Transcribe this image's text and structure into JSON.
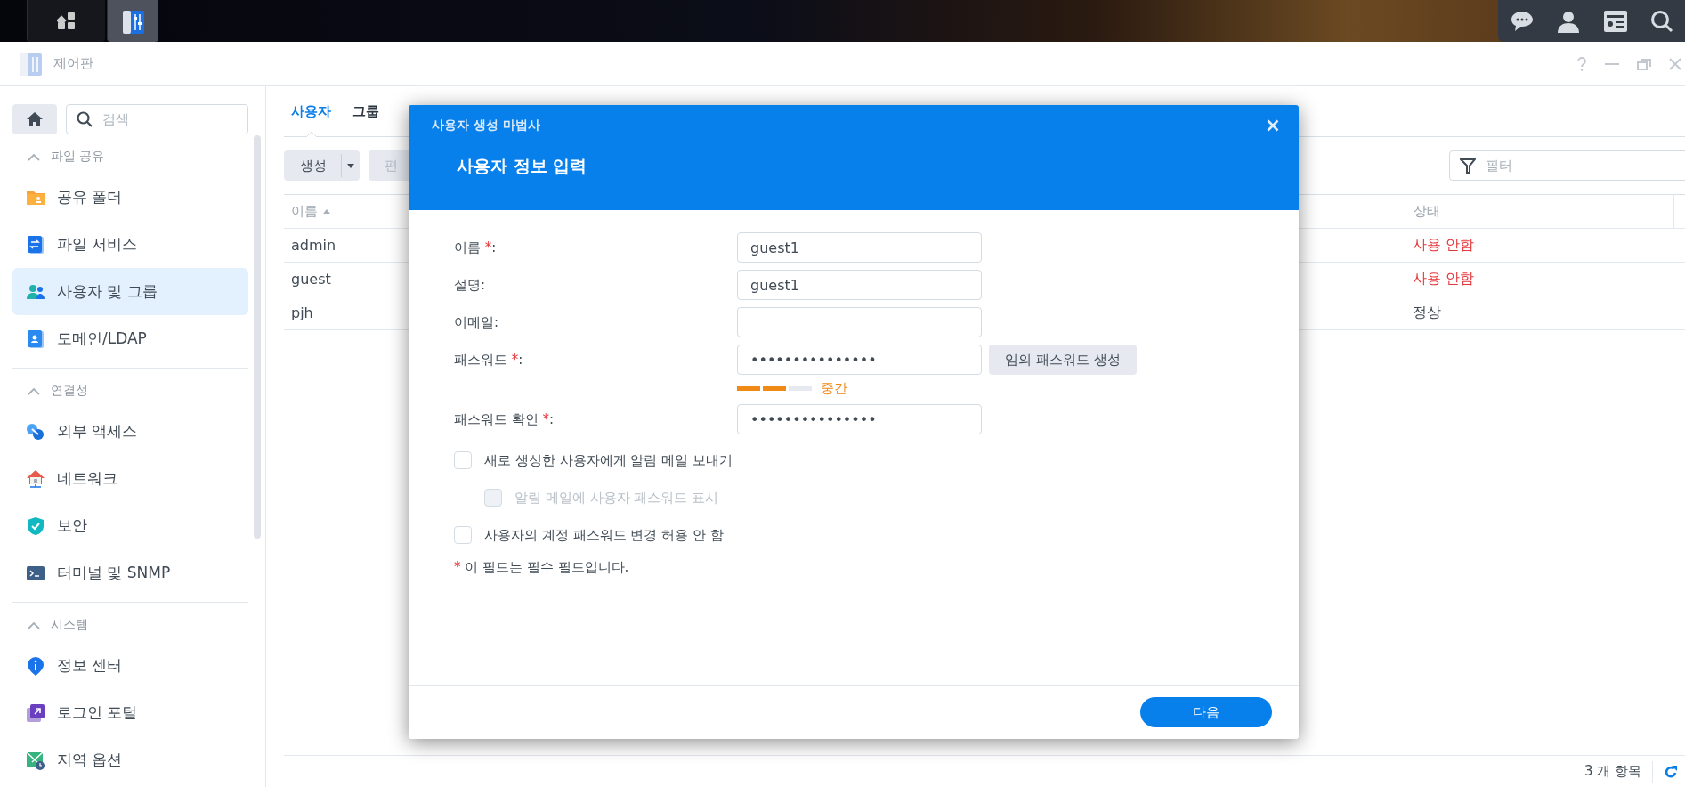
{
  "desktop": {
    "taskbar": [
      {
        "kind": "apps",
        "selected": false
      },
      {
        "kind": "control-panel",
        "selected": true
      }
    ]
  },
  "window": {
    "title": "제어판"
  },
  "sidebar": {
    "search": {
      "placeholder": "검색"
    },
    "sections": [
      {
        "title": "파일 공유",
        "expanded": true,
        "items": [
          {
            "label": "공유 폴더",
            "selected": false
          },
          {
            "label": "파일 서비스",
            "selected": false
          },
          {
            "label": "사용자 및 그룹",
            "selected": true
          },
          {
            "label": "도메인/LDAP",
            "selected": false
          }
        ]
      },
      {
        "title": "연결성",
        "expanded": true,
        "items": [
          {
            "label": "외부 액세스",
            "selected": false
          },
          {
            "label": "네트워크",
            "selected": false
          },
          {
            "label": "보안",
            "selected": false
          },
          {
            "label": "터미널 및 SNMP",
            "selected": false
          }
        ]
      },
      {
        "title": "시스템",
        "expanded": true,
        "items": [
          {
            "label": "정보 센터",
            "selected": false
          },
          {
            "label": "로그인 포털",
            "selected": false
          },
          {
            "label": "지역 옵션",
            "selected": false
          }
        ]
      }
    ]
  },
  "main": {
    "tabs": [
      {
        "label": "사용자",
        "selected": true
      },
      {
        "label": "그룹",
        "selected": false
      }
    ],
    "toolbar": {
      "buttons": [
        {
          "label": "생성",
          "kind": "split",
          "disabled": false
        },
        {
          "label": "편",
          "kind": "plain",
          "disabled": true
        }
      ],
      "filter": {
        "placeholder": "필터"
      }
    },
    "table": {
      "columns": [
        {
          "label": "이름",
          "sorted": true
        },
        {
          "label": "상태",
          "sorted": false
        }
      ],
      "rows": [
        {
          "name": "admin",
          "status": "사용 안함",
          "color": "#e5383b"
        },
        {
          "name": "guest",
          "status": "사용 안함",
          "color": "#e5383b"
        },
        {
          "name": "pjh",
          "status": "정상",
          "color": "#414b55"
        }
      ]
    },
    "footer": {
      "count": "3 개 항목"
    }
  },
  "dialog": {
    "title": "사용자 생성 마법사",
    "heading": "사용자 정보 입력",
    "required_mark": "*",
    "label_suffix": ":",
    "fields": [
      {
        "label": "이름",
        "required": true,
        "value": "guest1"
      },
      {
        "label": "설명",
        "required": false,
        "value": "guest1"
      },
      {
        "label": "이메일",
        "required": false
      },
      {
        "label": "패스워드",
        "required": true,
        "value": "•••••••••••••••",
        "button": "임의 패스워드 생성",
        "strength": {
          "level": 0.667,
          "label": "중간"
        }
      },
      {
        "label": "패스워드 확인",
        "required": true,
        "value": "•••••••••••••••"
      }
    ],
    "options": [
      {
        "label": "새로 생성한 사용자에게 알림 메일 보내기",
        "checked": false,
        "disabled": false,
        "children": [
          {
            "label": "알림 메일에 사용자 패스워드 표시",
            "checked": false,
            "disabled": true
          }
        ]
      },
      {
        "label": "사용자의 계정 패스워드 변경 허용 안 함",
        "checked": false,
        "disabled": false
      }
    ],
    "note": "이 필드는 필수 필드입니다.",
    "next_button": "다음"
  }
}
